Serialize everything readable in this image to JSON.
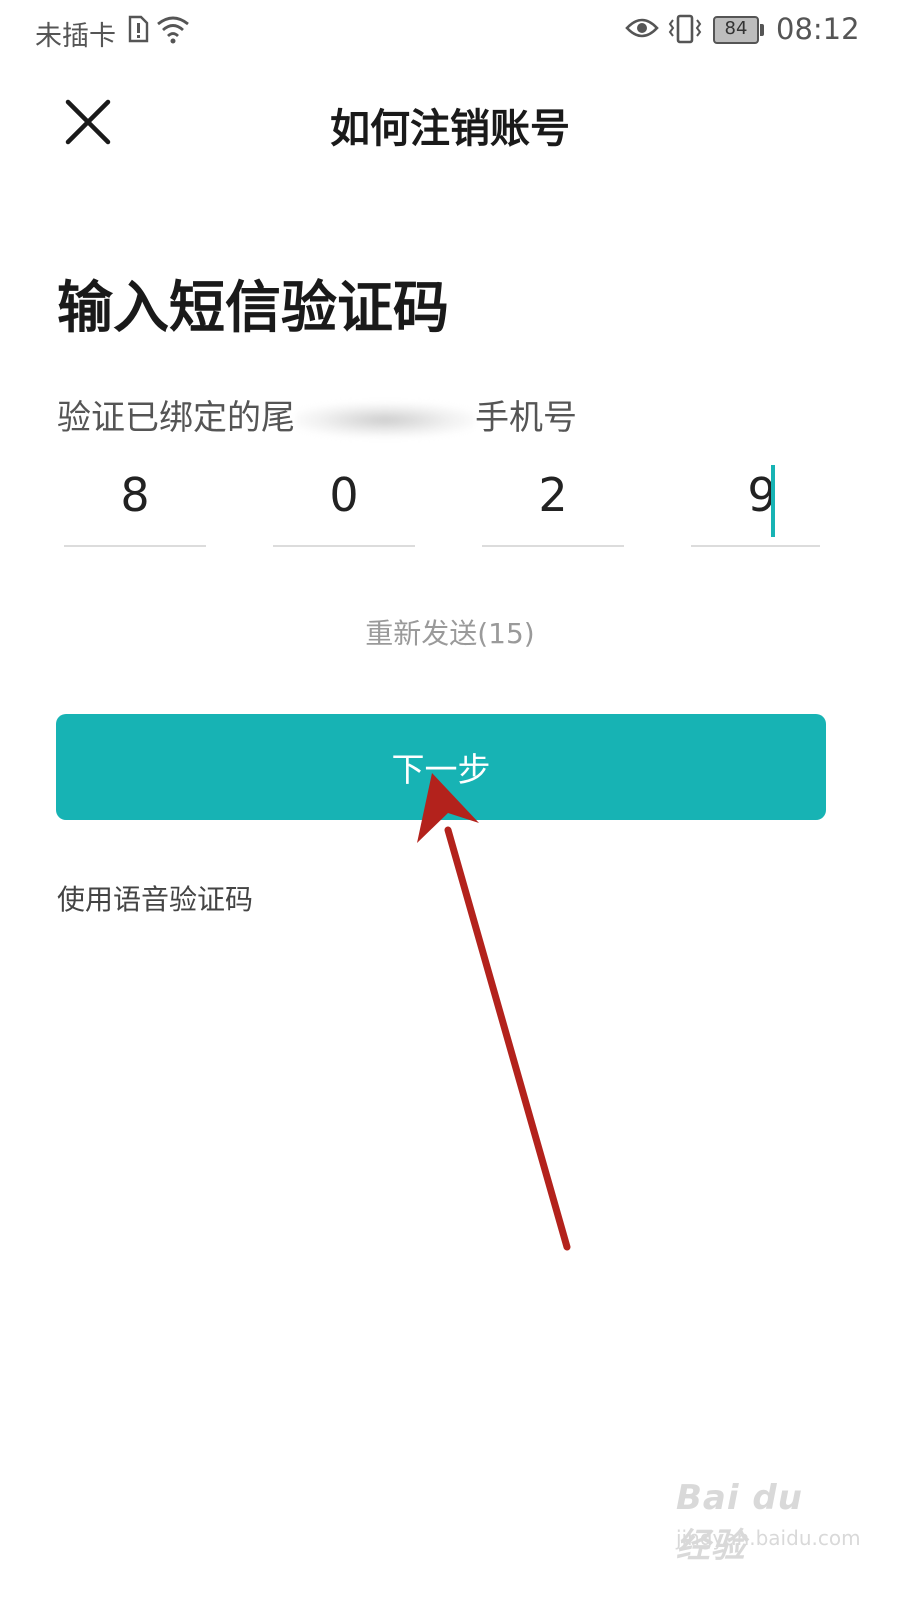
{
  "status_bar": {
    "carrier": "未插卡",
    "battery": "84",
    "time": "08:12"
  },
  "nav": {
    "title": "如何注销账号"
  },
  "content": {
    "heading": "输入短信验证码",
    "subtitle_prefix": "验证已绑定的尾",
    "subtitle_suffix": "手机号",
    "code_digits": [
      "8",
      "0",
      "2",
      "9"
    ],
    "resend": "重新发送(15)",
    "next_button": "下一步",
    "voice_code": "使用语音验证码"
  },
  "colors": {
    "accent": "#17b3b4",
    "arrow": "#b3221c"
  },
  "watermark": {
    "main": "Bai du 经验",
    "sub": "jingyan.baidu.com"
  }
}
